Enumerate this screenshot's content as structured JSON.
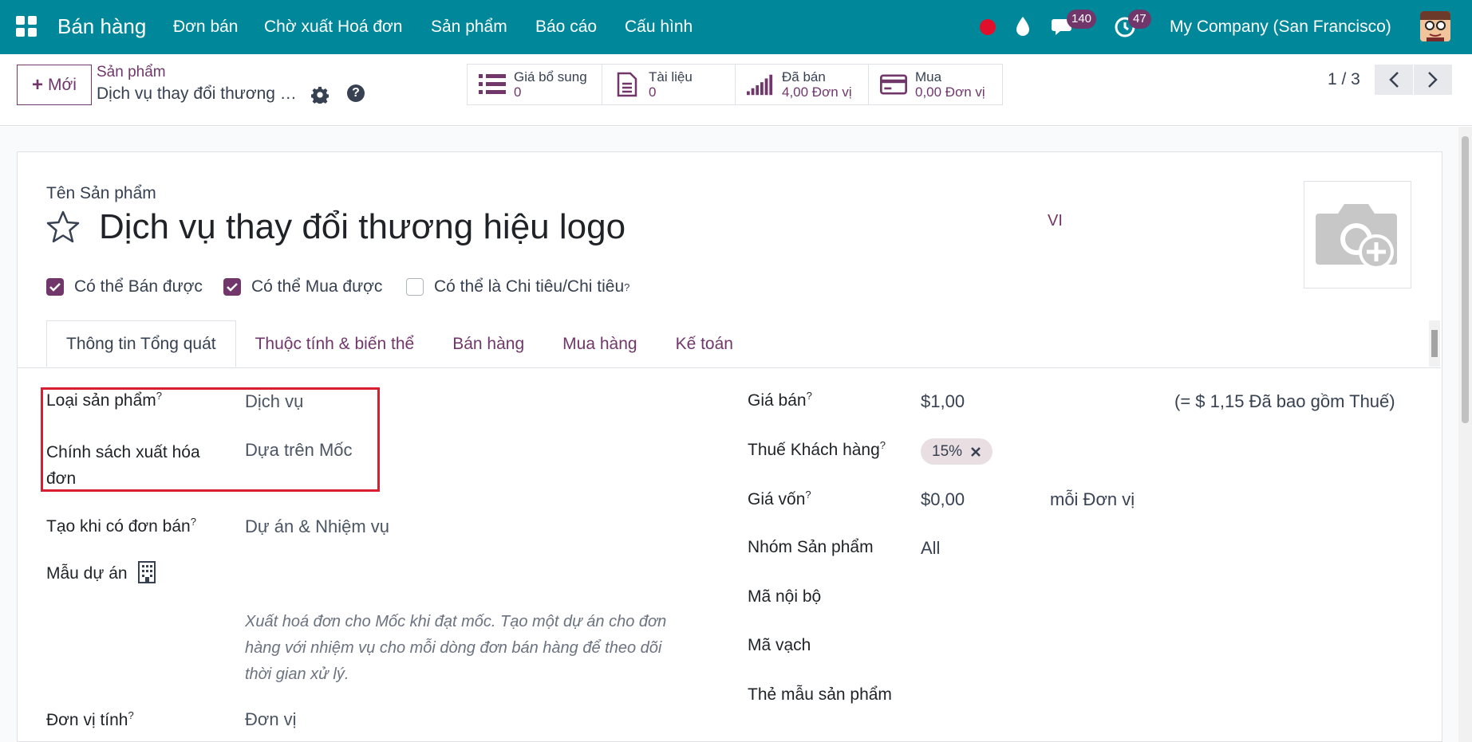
{
  "topbar": {
    "app_name": "Bán hàng",
    "menu": [
      "Đơn bán",
      "Chờ xuất Hoá đơn",
      "Sản phẩm",
      "Báo cáo",
      "Cấu hình"
    ],
    "messages_count": "140",
    "activities_count": "47",
    "company": "My Company (San Francisco)"
  },
  "control": {
    "new_label": "Mới",
    "breadcrumb_parent": "Sản phẩm",
    "breadcrumb_current": "Dịch vụ thay đổi thương hiệu logo",
    "smart_buttons": [
      {
        "label": "Giá bổ sung",
        "value": "0",
        "icon": "list-icon"
      },
      {
        "label": "Tài liệu",
        "value": "0",
        "icon": "document-icon"
      },
      {
        "label": "Đã bán",
        "value": "4,00 Đơn vị",
        "icon": "signal-chart-icon"
      },
      {
        "label": "Mua",
        "value": "0,00 Đơn vị",
        "icon": "credit-card-icon"
      }
    ],
    "pager": "1 / 3"
  },
  "form": {
    "name_label": "Tên Sản phẩm",
    "product_name": "Dịch vụ thay đổi thương hiệu logo",
    "lang": "VI",
    "checkboxes": [
      {
        "label": "Có thể Bán được",
        "checked": true
      },
      {
        "label": "Có thể Mua được",
        "checked": true
      },
      {
        "label": "Có thể là Chi tiêu/Chi tiêu",
        "checked": false
      }
    ],
    "tabs": [
      "Thông tin Tổng quát",
      "Thuộc tính & biến thể",
      "Bán hàng",
      "Mua hàng",
      "Kế toán"
    ],
    "left": {
      "product_type_label": "Loại sản phẩm",
      "product_type_value": "Dịch vụ",
      "invoice_policy_label": "Chính sách xuất hóa đơn",
      "invoice_policy_value": "Dựa trên Mốc",
      "create_on_order_label": "Tạo khi có đơn bán",
      "create_on_order_value": "Dự án & Nhiệm vụ",
      "project_template_label": "Mẫu dự án",
      "help_text": "Xuất hoá đơn cho Mốc khi đạt mốc. Tạo một dự án cho đơn hàng với nhiệm vụ cho mỗi dòng đơn bán hàng để theo dõi thời gian xử lý.",
      "uom_label": "Đơn vị tính",
      "uom_value": "Đơn vị"
    },
    "right": {
      "sale_price_label": "Giá bán",
      "sale_price_value": "$1,00",
      "sale_price_incl": "(= $ 1,15 Đã bao gồm Thuế)",
      "customer_tax_label": "Thuế Khách hàng",
      "customer_tax_value": "15%",
      "cost_label": "Giá vốn",
      "cost_value": "$0,00",
      "cost_unit": "mỗi Đơn vị",
      "category_label": "Nhóm Sản phẩm",
      "category_value": "All",
      "internal_ref_label": "Mã nội bộ",
      "barcode_label": "Mã vạch",
      "product_tags_label": "Thẻ mẫu sản phẩm"
    },
    "tooltip_mark": "?"
  },
  "colors": {
    "topbar": "#00889a",
    "accent": "#71376b",
    "highlight": "#d91f2f"
  }
}
